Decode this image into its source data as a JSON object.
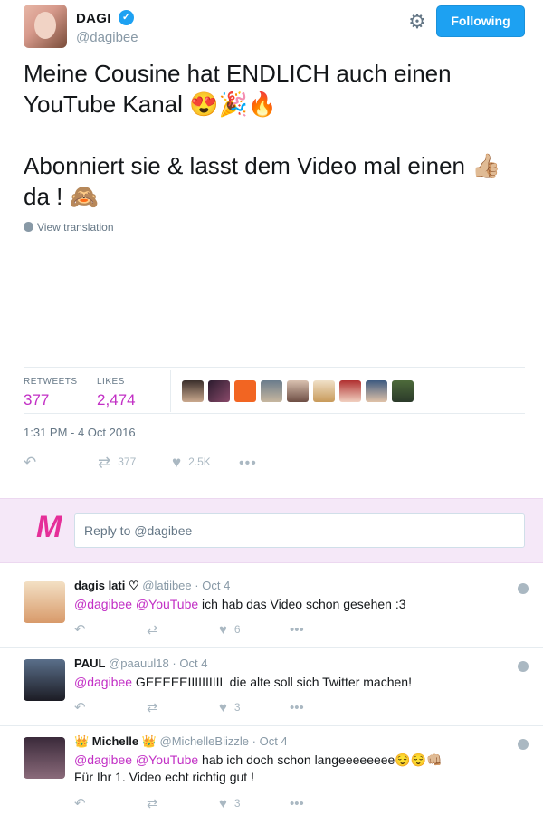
{
  "tweet": {
    "author_name": "DAGI",
    "author_handle": "@dagibee",
    "follow_label": "Following",
    "text_line1": "Meine Cousine hat ENDLICH auch einen YouTube Kanal 😍🎉🔥",
    "text_line2": "Abonniert sie & lasst dem Video mal einen 👍🏼 da ! 🙈",
    "translate_label": "View translation",
    "stats": {
      "retweets_label": "RETWEETS",
      "retweets_value": "377",
      "likes_label": "LIKES",
      "likes_value": "2,474"
    },
    "timestamp": "1:31 PM - 4 Oct 2016",
    "actions": {
      "retweet_count": "377",
      "like_count": "2.5K"
    }
  },
  "compose": {
    "placeholder": "Reply to @dagibee"
  },
  "replies": [
    {
      "name": "dagis lati ♡",
      "handle": "@latiibee",
      "time": "Oct 4",
      "mentions": "@dagibee @YouTube",
      "text": " ich hab das Video schon gesehen :3",
      "like_count": "6"
    },
    {
      "name": "PAUL",
      "handle": "@paauul18",
      "time": "Oct 4",
      "mentions": "@dagibee",
      "text": " GEEEEEIIIIIIIIIL die alte soll sich Twitter machen!",
      "like_count": "3"
    },
    {
      "name": "👑 Michelle 👑",
      "handle": "@MichelleBiizzle",
      "time": "Oct 4",
      "mentions": "@dagibee @YouTube",
      "text": " hab ich doch schon langeeeeeeee😌😌👊🏼",
      "text2": "Für Ihr 1. Video echt richtig gut !",
      "like_count": "3"
    }
  ],
  "colors": {
    "accent": "#c22fc5",
    "brand_blue": "#1da1f2",
    "reply_bg": "#f5e8f8",
    "logo": "#e52f99"
  }
}
